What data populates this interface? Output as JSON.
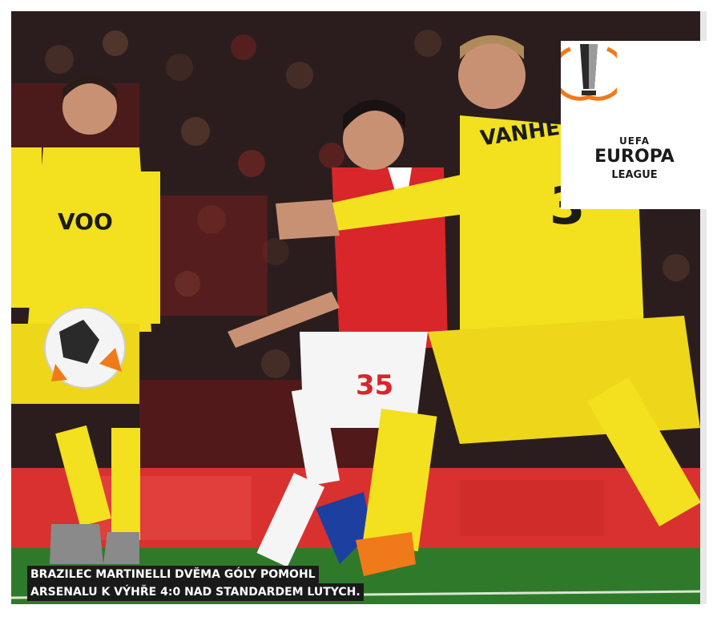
{
  "caption": {
    "line1": "BRAZILEC MARTINELLI DVĚMA GÓLY POMOHL",
    "line2": "ARSENALU K VÝHŘE 4:0 NAD STANDARDEM LUTYCH."
  },
  "logo": {
    "uefa": "UEFA",
    "title": "EUROPA",
    "subtitle": "LEAGUE",
    "colors": {
      "ring": "#f07a19",
      "text": "#1b1b1b",
      "background": "#ffffff"
    }
  },
  "photo": {
    "jersey_sponsor": "VOO",
    "shirt_name": "VANHEUSD",
    "shirt_number_player": "35",
    "shirt_number_opponent": "3",
    "colors": {
      "yellow_kit": "#f3e01f",
      "red_kit": "#d8262b",
      "pitch": "#2f7a2a",
      "crowd": "#2a1c1c",
      "board": "#d9312f"
    }
  }
}
